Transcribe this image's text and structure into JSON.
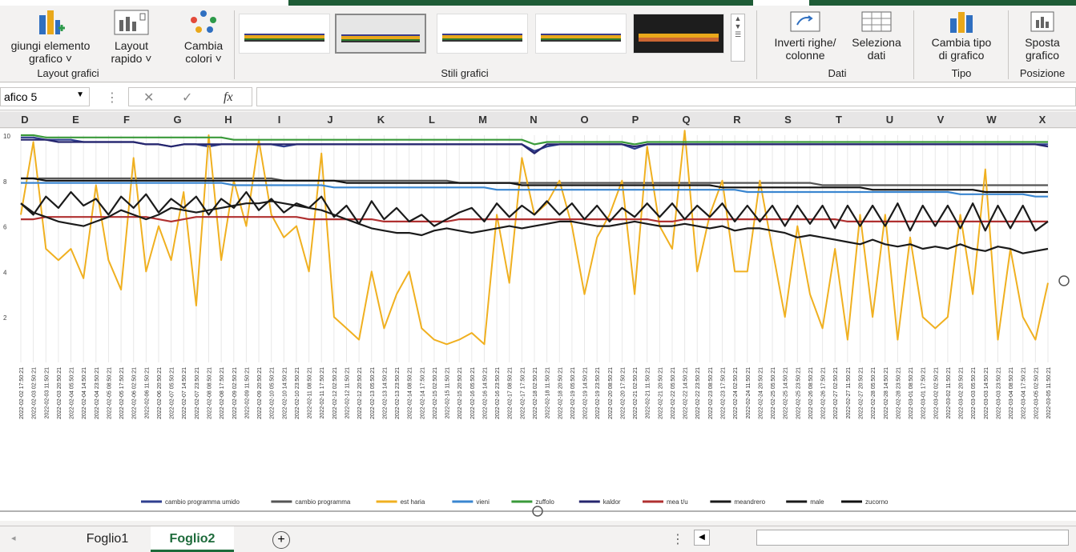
{
  "ribbon": {
    "add_element": "giungi elemento\ngrafico ˅",
    "quick_layout": "Layout\nrapido ˅",
    "change_colors": "Cambia\ncolori ˅",
    "group_layout": "Layout grafici",
    "group_styles": "Stili grafici",
    "switch_rows": "Inverti righe/\ncolonne",
    "select_data": "Seleziona\ndati",
    "group_data": "Dati",
    "change_type": "Cambia tipo\ndi grafico",
    "group_type": "Tipo",
    "move_chart": "Sposta\ngrafico",
    "group_position": "Posizione"
  },
  "formula_bar": {
    "name_box": "afico 5",
    "fx": "fx",
    "value": ""
  },
  "columns": [
    "D",
    "E",
    "F",
    "G",
    "H",
    "I",
    "J",
    "K",
    "L",
    "M",
    "N",
    "O",
    "P",
    "Q",
    "R",
    "S",
    "T",
    "U",
    "V",
    "W",
    "X"
  ],
  "tabs": {
    "sheet1": "Foglio1",
    "sheet2": "Foglio2",
    "add": "+"
  },
  "chart_data": {
    "type": "line",
    "ylim": [
      0,
      10
    ],
    "yticks": [
      "10",
      "8",
      "6",
      "4",
      "2"
    ],
    "x": [
      "2022-02-02 17:50:21",
      "2022-02-03 02:50:21",
      "2022-02-03 11:50:21",
      "2022-02-03 20:50:21",
      "2022-02-04 05:50:21",
      "2022-02-04 14:50:21",
      "2022-02-04 23:50:21",
      "2022-02-05 08:50:21",
      "2022-02-05 17:50:21",
      "2022-02-06 02:50:21",
      "2022-02-06 11:50:21",
      "2022-02-06 20:50:21",
      "2022-02-07 05:50:21",
      "2022-02-07 14:50:21",
      "2022-02-07 23:50:21",
      "2022-02-08 08:50:21",
      "2022-02-08 17:50:21",
      "2022-02-09 02:50:21",
      "2022-02-09 11:50:21",
      "2022-02-09 20:50:21",
      "2022-02-10 05:50:21",
      "2022-02-10 14:50:21",
      "2022-02-10 23:50:21",
      "2022-02-11 08:50:21",
      "2022-02-11 17:50:21",
      "2022-02-12 02:50:21",
      "2022-02-12 11:50:21",
      "2022-02-12 20:50:21",
      "2022-02-13 05:50:21",
      "2022-02-13 14:50:21",
      "2022-02-13 23:50:21",
      "2022-02-14 08:50:21",
      "2022-02-14 17:50:21",
      "2022-02-15 02:50:21",
      "2022-02-15 11:50:21",
      "2022-02-15 20:50:21",
      "2022-02-16 05:50:21",
      "2022-02-16 14:50:21",
      "2022-02-16 23:50:21",
      "2022-02-17 08:50:21",
      "2022-02-17 17:50:21",
      "2022-02-18 02:50:21",
      "2022-02-18 11:50:21",
      "2022-02-18 20:50:21",
      "2022-02-19 05:50:21",
      "2022-02-19 14:50:21",
      "2022-02-19 23:50:21",
      "2022-02-20 08:50:21",
      "2022-02-20 17:50:21",
      "2022-02-21 02:50:21",
      "2022-02-21 11:50:21",
      "2022-02-21 20:50:21",
      "2022-02-22 05:50:21",
      "2022-02-22 14:50:21",
      "2022-02-22 23:50:21",
      "2022-02-23 08:50:21",
      "2022-02-23 17:50:21",
      "2022-02-24 02:50:21",
      "2022-02-24 11:50:21",
      "2022-02-24 20:50:21",
      "2022-02-25 05:50:21",
      "2022-02-25 14:50:21",
      "2022-02-25 23:50:21",
      "2022-02-26 08:50:21",
      "2022-02-26 17:50:21",
      "2022-02-27 02:50:21",
      "2022-02-27 11:50:21",
      "2022-02-27 20:50:21",
      "2022-02-28 05:50:21",
      "2022-02-28 14:50:21",
      "2022-02-28 23:50:21",
      "2022-03-01 08:50:21",
      "2022-03-01 17:50:21",
      "2022-03-02 02:50:21",
      "2022-03-02 11:50:21",
      "2022-03-02 20:50:21",
      "2022-03-03 05:50:21",
      "2022-03-03 14:50:21",
      "2022-03-03 23:50:21",
      "2022-03-04 08:50:21",
      "2022-03-04 17:50:21",
      "2022-03-05 02:50:21",
      "2022-03-05 11:50:21"
    ],
    "series": [
      {
        "name": "cambio programma umido",
        "color": "#2f3f8f",
        "values": [
          9.9,
          9.9,
          9.8,
          9.8,
          9.8,
          9.7,
          9.7,
          9.7,
          9.7,
          9.7,
          9.6,
          9.6,
          9.5,
          9.6,
          9.6,
          9.5,
          9.6,
          9.6,
          9.6,
          9.6,
          9.6,
          9.5,
          9.6,
          9.6,
          9.6,
          9.6,
          9.6,
          9.6,
          9.6,
          9.6,
          9.6,
          9.6,
          9.6,
          9.6,
          9.6,
          9.6,
          9.6,
          9.6,
          9.6,
          9.6,
          9.6,
          9.3,
          9.5,
          9.6,
          9.6,
          9.6,
          9.6,
          9.6,
          9.6,
          9.4,
          9.6,
          9.6,
          9.6,
          9.6,
          9.6,
          9.6,
          9.6,
          9.6,
          9.6,
          9.6,
          9.6,
          9.6,
          9.6,
          9.6,
          9.6,
          9.6,
          9.6,
          9.6,
          9.6,
          9.6,
          9.6,
          9.6,
          9.6,
          9.6,
          9.6,
          9.6,
          9.6,
          9.6,
          9.6,
          9.6,
          9.6,
          9.6,
          9.6
        ]
      },
      {
        "name": "cambio programma",
        "color": "#555555",
        "values": [
          8.1,
          8.1,
          8.1,
          8.1,
          8.1,
          8.1,
          8.1,
          8.1,
          8.1,
          8.1,
          8.1,
          8.1,
          8.1,
          8.1,
          8.1,
          8.1,
          8.1,
          8.1,
          8.1,
          8.1,
          8.1,
          8.0,
          8.0,
          8.0,
          8.0,
          8.0,
          8.0,
          8.0,
          8.0,
          8.0,
          8.0,
          8.0,
          8.0,
          8.0,
          8.0,
          7.9,
          7.9,
          7.9,
          7.9,
          7.9,
          7.9,
          7.9,
          7.9,
          7.9,
          7.9,
          7.9,
          7.9,
          7.9,
          7.9,
          7.9,
          7.9,
          7.9,
          7.9,
          7.9,
          7.9,
          7.9,
          7.9,
          7.9,
          7.9,
          7.9,
          7.9,
          7.9,
          7.9,
          7.9,
          7.8,
          7.8,
          7.8,
          7.8,
          7.8,
          7.8,
          7.8,
          7.8,
          7.8,
          7.8,
          7.8,
          7.8,
          7.8,
          7.8,
          7.8,
          7.8,
          7.8,
          7.8,
          7.8
        ]
      },
      {
        "name": "est haria",
        "color": "#f0b020",
        "values": [
          6.5,
          9.7,
          5.0,
          4.5,
          5.0,
          3.7,
          7.8,
          4.5,
          3.2,
          9.0,
          4.0,
          6.0,
          4.5,
          7.5,
          2.5,
          10.0,
          4.5,
          8.0,
          6.0,
          9.8,
          6.5,
          5.5,
          6.0,
          4.0,
          9.2,
          2.0,
          1.5,
          1.0,
          4.0,
          1.5,
          3.0,
          4.0,
          1.5,
          1.0,
          0.8,
          1.0,
          1.3,
          0.8,
          6.5,
          3.5,
          9.0,
          6.5,
          7.0,
          8.0,
          6.0,
          3.0,
          5.5,
          6.5,
          8.0,
          3.0,
          9.5,
          6.0,
          5.0,
          10.2,
          4.0,
          6.5,
          8.0,
          4.0,
          4.0,
          8.0,
          5.0,
          2.0,
          6.0,
          3.0,
          1.5,
          5.0,
          1.0,
          6.5,
          2.0,
          6.5,
          1.0,
          5.5,
          2.0,
          1.5,
          2.0,
          6.5,
          3.0,
          8.5,
          1.0,
          5.0,
          2.0,
          1.0,
          3.5
        ]
      },
      {
        "name": "vieni",
        "color": "#3a86d0",
        "values": [
          7.9,
          7.9,
          7.9,
          7.9,
          7.9,
          7.9,
          7.9,
          7.9,
          7.9,
          7.9,
          7.9,
          7.9,
          7.9,
          7.9,
          7.9,
          7.9,
          7.9,
          7.8,
          7.8,
          7.8,
          7.8,
          7.8,
          7.8,
          7.8,
          7.8,
          7.7,
          7.7,
          7.7,
          7.7,
          7.7,
          7.7,
          7.7,
          7.7,
          7.7,
          7.7,
          7.7,
          7.7,
          7.7,
          7.6,
          7.6,
          7.6,
          7.6,
          7.6,
          7.6,
          7.6,
          7.6,
          7.6,
          7.6,
          7.6,
          7.6,
          7.6,
          7.6,
          7.6,
          7.6,
          7.6,
          7.6,
          7.6,
          7.6,
          7.5,
          7.5,
          7.5,
          7.5,
          7.5,
          7.5,
          7.5,
          7.5,
          7.5,
          7.5,
          7.5,
          7.5,
          7.5,
          7.5,
          7.5,
          7.5,
          7.5,
          7.4,
          7.4,
          7.4,
          7.4,
          7.4,
          7.4,
          7.3,
          7.3
        ]
      },
      {
        "name": "zuffolo",
        "color": "#3a9a3a",
        "values": [
          10.0,
          10.0,
          9.9,
          9.9,
          9.9,
          9.9,
          9.9,
          9.9,
          9.9,
          9.9,
          9.9,
          9.9,
          9.9,
          9.9,
          9.9,
          9.9,
          9.9,
          9.8,
          9.8,
          9.8,
          9.8,
          9.8,
          9.8,
          9.8,
          9.8,
          9.8,
          9.8,
          9.8,
          9.8,
          9.8,
          9.8,
          9.8,
          9.8,
          9.8,
          9.8,
          9.8,
          9.8,
          9.8,
          9.8,
          9.8,
          9.8,
          9.6,
          9.7,
          9.7,
          9.7,
          9.7,
          9.7,
          9.7,
          9.7,
          9.6,
          9.7,
          9.7,
          9.7,
          9.7,
          9.7,
          9.7,
          9.7,
          9.7,
          9.7,
          9.7,
          9.7,
          9.7,
          9.7,
          9.7,
          9.7,
          9.7,
          9.7,
          9.7,
          9.7,
          9.7,
          9.7,
          9.7,
          9.7,
          9.7,
          9.7,
          9.7,
          9.7,
          9.7,
          9.7,
          9.7,
          9.7,
          9.7,
          9.7
        ]
      },
      {
        "name": "kaldor",
        "color": "#26266e",
        "values": [
          9.8,
          9.8,
          9.8,
          9.7,
          9.7,
          9.7,
          9.7,
          9.7,
          9.7,
          9.7,
          9.6,
          9.6,
          9.5,
          9.6,
          9.6,
          9.6,
          9.6,
          9.6,
          9.6,
          9.6,
          9.6,
          9.6,
          9.6,
          9.6,
          9.6,
          9.6,
          9.6,
          9.6,
          9.6,
          9.6,
          9.6,
          9.6,
          9.6,
          9.6,
          9.6,
          9.6,
          9.6,
          9.6,
          9.6,
          9.6,
          9.6,
          9.2,
          9.6,
          9.6,
          9.6,
          9.6,
          9.6,
          9.6,
          9.6,
          9.5,
          9.6,
          9.6,
          9.6,
          9.6,
          9.6,
          9.6,
          9.6,
          9.6,
          9.6,
          9.6,
          9.6,
          9.6,
          9.6,
          9.6,
          9.6,
          9.6,
          9.6,
          9.6,
          9.6,
          9.6,
          9.6,
          9.6,
          9.6,
          9.6,
          9.6,
          9.6,
          9.6,
          9.6,
          9.6,
          9.6,
          9.6,
          9.6,
          9.5
        ]
      },
      {
        "name": "mea t/u",
        "color": "#b03030",
        "values": [
          6.3,
          6.3,
          6.4,
          6.4,
          6.4,
          6.4,
          6.4,
          6.4,
          6.4,
          6.4,
          6.4,
          6.3,
          6.2,
          6.3,
          6.4,
          6.4,
          6.4,
          6.4,
          6.4,
          6.4,
          6.4,
          6.4,
          6.4,
          6.3,
          6.3,
          6.3,
          6.3,
          6.3,
          6.3,
          6.2,
          6.2,
          6.2,
          6.2,
          6.2,
          6.2,
          6.3,
          6.3,
          6.3,
          6.3,
          6.3,
          6.3,
          6.3,
          6.3,
          6.3,
          6.3,
          6.3,
          6.3,
          6.3,
          6.3,
          6.3,
          6.3,
          6.2,
          6.2,
          6.3,
          6.3,
          6.3,
          6.3,
          6.3,
          6.3,
          6.3,
          6.3,
          6.3,
          6.3,
          6.3,
          6.3,
          6.3,
          6.2,
          6.2,
          6.2,
          6.2,
          6.2,
          6.2,
          6.2,
          6.2,
          6.2,
          6.2,
          6.2,
          6.2,
          6.2,
          6.2,
          6.2,
          6.2,
          6.2
        ]
      },
      {
        "name": "meandrero",
        "color": "#1a1a1a",
        "values": [
          7.0,
          6.5,
          7.3,
          6.8,
          7.5,
          6.9,
          7.2,
          6.5,
          7.3,
          6.8,
          7.4,
          6.6,
          7.2,
          6.8,
          7.3,
          6.5,
          7.2,
          6.8,
          7.5,
          6.7,
          7.2,
          6.6,
          7.0,
          6.8,
          7.3,
          6.4,
          6.9,
          6.1,
          7.1,
          6.3,
          6.8,
          6.2,
          6.5,
          6.0,
          6.3,
          6.6,
          6.8,
          6.2,
          7.0,
          6.4,
          6.9,
          6.5,
          7.1,
          6.5,
          7.0,
          6.3,
          6.9,
          6.2,
          6.8,
          6.4,
          7.0,
          6.4,
          7.0,
          6.3,
          6.9,
          6.4,
          7.0,
          6.2,
          6.9,
          6.2,
          6.9,
          6.0,
          6.9,
          6.1,
          6.9,
          5.9,
          6.9,
          6.0,
          6.9,
          6.0,
          7.0,
          5.8,
          6.9,
          6.0,
          6.9,
          5.9,
          7.0,
          5.8,
          6.9,
          5.9,
          6.9,
          5.8,
          6.2
        ]
      },
      {
        "name": "male",
        "color": "#1a1a1a",
        "values": [
          7.0,
          6.6,
          6.4,
          6.2,
          6.1,
          6.0,
          6.2,
          6.4,
          6.7,
          6.5,
          6.3,
          6.5,
          6.8,
          6.7,
          6.6,
          6.7,
          6.8,
          6.9,
          7.0,
          7.0,
          7.1,
          7.0,
          6.9,
          6.8,
          6.7,
          6.5,
          6.3,
          6.1,
          5.9,
          5.8,
          5.7,
          5.7,
          5.6,
          5.8,
          5.9,
          5.8,
          5.7,
          5.8,
          5.9,
          6.0,
          5.9,
          6.0,
          6.1,
          6.2,
          6.2,
          6.1,
          6.0,
          6.0,
          6.1,
          6.2,
          6.1,
          6.0,
          6.0,
          6.1,
          6.0,
          5.9,
          6.0,
          5.8,
          5.9,
          5.9,
          5.8,
          5.7,
          5.5,
          5.6,
          5.5,
          5.4,
          5.3,
          5.2,
          5.4,
          5.2,
          5.1,
          5.2,
          5.0,
          5.1,
          5.0,
          5.2,
          5.0,
          4.9,
          5.1,
          5.0,
          4.8,
          4.9,
          5.0
        ]
      },
      {
        "name": "zucorno",
        "color": "#111111",
        "values": [
          8.1,
          8.1,
          8.0,
          8.0,
          8.0,
          8.0,
          8.0,
          8.0,
          8.0,
          8.0,
          8.0,
          8.0,
          8.0,
          8.0,
          8.0,
          8.0,
          8.0,
          8.0,
          8.0,
          8.0,
          8.0,
          8.0,
          8.0,
          8.0,
          8.0,
          8.0,
          7.9,
          7.9,
          7.9,
          7.9,
          7.9,
          7.9,
          7.9,
          7.9,
          7.9,
          7.9,
          7.9,
          7.9,
          7.9,
          7.9,
          7.8,
          7.8,
          7.8,
          7.8,
          7.8,
          7.8,
          7.8,
          7.8,
          7.8,
          7.8,
          7.8,
          7.8,
          7.8,
          7.8,
          7.8,
          7.8,
          7.7,
          7.7,
          7.7,
          7.7,
          7.7,
          7.7,
          7.7,
          7.7,
          7.7,
          7.7,
          7.7,
          7.7,
          7.6,
          7.6,
          7.6,
          7.6,
          7.6,
          7.6,
          7.6,
          7.6,
          7.6,
          7.5,
          7.5,
          7.5,
          7.5,
          7.5,
          7.5
        ]
      }
    ]
  }
}
